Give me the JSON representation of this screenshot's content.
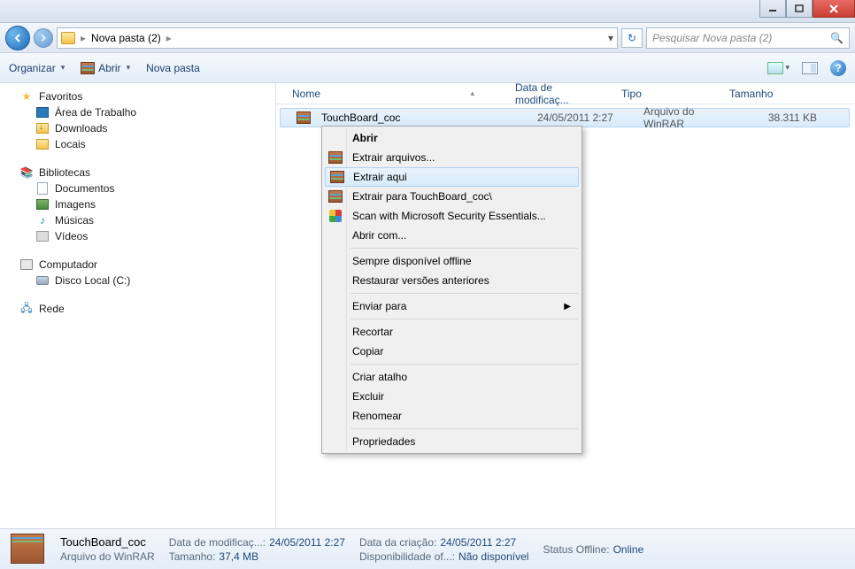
{
  "address": {
    "path": "Nova pasta (2)"
  },
  "search": {
    "placeholder": "Pesquisar Nova pasta (2)"
  },
  "toolbar": {
    "organize": "Organizar",
    "open": "Abrir",
    "new_folder": "Nova pasta"
  },
  "sidebar": {
    "favorites": "Favoritos",
    "desktop": "Área de Trabalho",
    "downloads": "Downloads",
    "places": "Locais",
    "libraries": "Bibliotecas",
    "documents": "Documentos",
    "pictures": "Imagens",
    "music": "Músicas",
    "videos": "Vídeos",
    "computer": "Computador",
    "local_disk": "Disco Local (C:)",
    "network": "Rede"
  },
  "columns": {
    "name": "Nome",
    "date": "Data de modificaç...",
    "type": "Tipo",
    "size": "Tamanho"
  },
  "files": [
    {
      "name": "TouchBoard_coc",
      "date": "24/05/2011 2:27",
      "type": "Arquivo do WinRAR",
      "size": "38.311 KB"
    }
  ],
  "context_menu": {
    "open": "Abrir",
    "extract_files": "Extrair arquivos...",
    "extract_here": "Extrair aqui",
    "extract_to": "Extrair para TouchBoard_coc\\",
    "scan": "Scan with Microsoft Security Essentials...",
    "open_with": "Abrir com...",
    "always_offline": "Sempre disponível offline",
    "restore_prev": "Restaurar versões anteriores",
    "send_to": "Enviar para",
    "cut": "Recortar",
    "copy": "Copiar",
    "shortcut": "Criar atalho",
    "delete": "Excluir",
    "rename": "Renomear",
    "properties": "Propriedades"
  },
  "statusbar": {
    "file_name": "TouchBoard_coc",
    "file_type": "Arquivo do WinRAR",
    "mod_label": "Data de modificaç...:",
    "mod_value": "24/05/2011 2:27",
    "size_label": "Tamanho:",
    "size_value": "37,4 MB",
    "created_label": "Data da criação:",
    "created_value": "24/05/2011 2:27",
    "avail_label": "Disponibilidade of...:",
    "avail_value": "Não disponível",
    "offline_label": "Status Offline:",
    "offline_value": "Online"
  }
}
